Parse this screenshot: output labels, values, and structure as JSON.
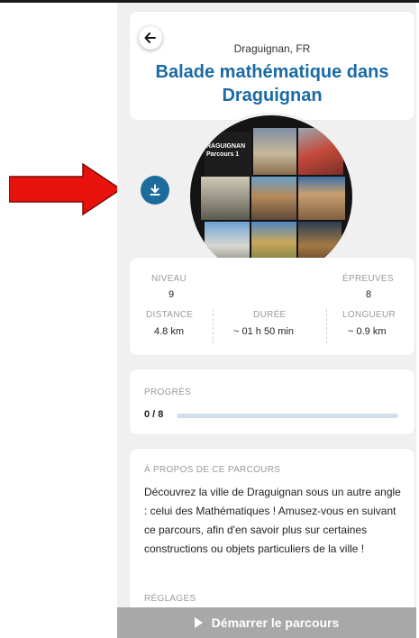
{
  "header": {
    "location": "Draguignan, FR",
    "title": "Balade mathématique dans Draguignan"
  },
  "cover": {
    "label_line1": "RAGUIGNAN",
    "label_line2": "Parcours 1"
  },
  "stats": {
    "level_label": "NIVEAU",
    "level_value": "9",
    "tests_label": "ÉPREUVES",
    "tests_value": "8",
    "distance_label": "DISTANCE",
    "distance_value": "4.8 km",
    "duration_label": "DURÉE",
    "duration_value": "~ 01 h 50 min",
    "length_label": "LONGUEUR",
    "length_value": "~ 0.9 km"
  },
  "progress": {
    "label": "PROGRÈS",
    "value": "0 / 8",
    "fraction": 0
  },
  "about": {
    "label": "À PROPOS DE CE PARCOURS",
    "text": "Découvrez la ville de Draguignan sous un autre angle : celui des Mathématiques ! Amusez-vous en suivant ce parcours, afin d'en savoir plus sur certaines constructions ou objets particuliers de la ville !",
    "settings_label": "RÉGLAGES"
  },
  "action": {
    "start_label": "Démarrer le parcours"
  },
  "colors": {
    "accent": "#1e6c9e",
    "title": "#1a6aa6",
    "arrow": "#e8120c"
  }
}
